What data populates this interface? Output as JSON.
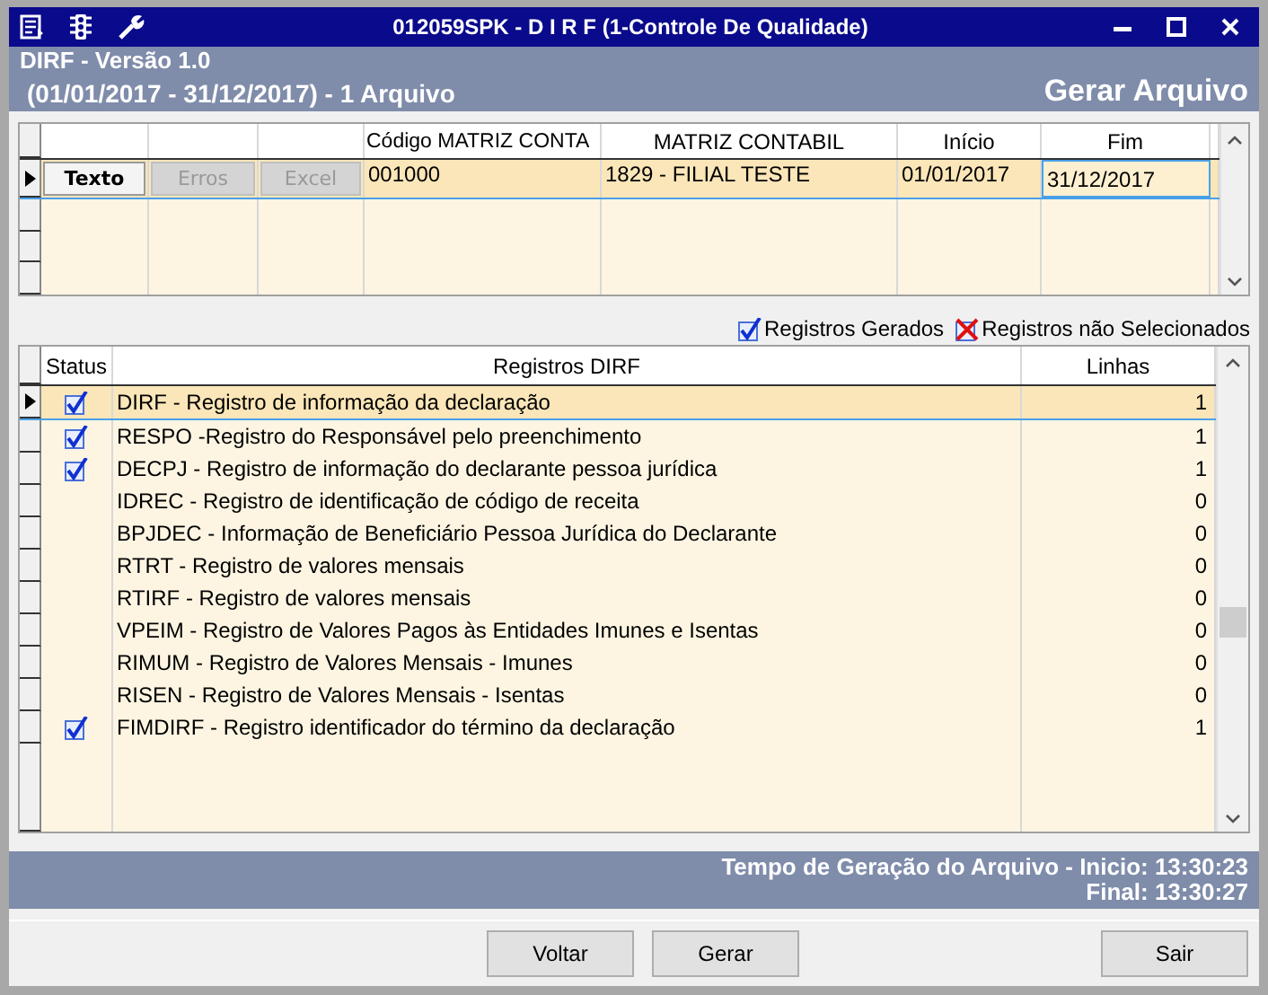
{
  "window": {
    "title": "012059SPK - D I R F (1-Controle De Qualidade)"
  },
  "header": {
    "version": "DIRF - Versão 1.0",
    "period": "(01/01/2017 - 31/12/2017) - 1 Arquivo",
    "action": "Gerar Arquivo"
  },
  "files_table": {
    "columns": [
      "Código MATRIZ CONTA",
      "MATRIZ CONTABIL",
      "Início",
      "Fim"
    ],
    "rows": [
      {
        "selected": true,
        "buttons": [
          {
            "label": "Texto",
            "disabled": false
          },
          {
            "label": "Erros",
            "disabled": true
          },
          {
            "label": "Excel",
            "disabled": true
          }
        ],
        "cells": [
          "001000",
          "1829 - FILIAL TESTE",
          "01/01/2017",
          "31/12/2017"
        ]
      }
    ]
  },
  "legend": [
    {
      "kind": "generated",
      "label": "Registros Gerados"
    },
    {
      "kind": "not_selected",
      "label": "Registros não Selecionados"
    }
  ],
  "records_table": {
    "columns": [
      "Status",
      "Registros DIRF",
      "Linhas"
    ],
    "rows": [
      {
        "selected": true,
        "checked": true,
        "text": "DIRF - Registro de informação da declaração",
        "lines": "1"
      },
      {
        "selected": false,
        "checked": true,
        "text": "RESPO -Registro do Responsável pelo preenchimento",
        "lines": "1"
      },
      {
        "selected": false,
        "checked": true,
        "text": "DECPJ - Registro de informação do declarante pessoa jurídica",
        "lines": "1"
      },
      {
        "selected": false,
        "checked": false,
        "text": "IDREC - Registro de identificação de código de receita",
        "lines": "0"
      },
      {
        "selected": false,
        "checked": false,
        "text": "BPJDEC - Informação de Beneficiário Pessoa Jurídica do Declarante",
        "lines": "0"
      },
      {
        "selected": false,
        "checked": false,
        "text": "RTRT - Registro de valores mensais",
        "lines": "0"
      },
      {
        "selected": false,
        "checked": false,
        "text": "RTIRF - Registro de valores mensais",
        "lines": "0"
      },
      {
        "selected": false,
        "checked": false,
        "text": "VPEIM - Registro de Valores Pagos às Entidades Imunes e Isentas",
        "lines": "0"
      },
      {
        "selected": false,
        "checked": false,
        "text": "RIMUM - Registro de Valores Mensais - Imunes",
        "lines": "0"
      },
      {
        "selected": false,
        "checked": false,
        "text": "RISEN - Registro de Valores Mensais - Isentas",
        "lines": "0"
      },
      {
        "selected": false,
        "checked": true,
        "text": "FIMDIRF - Registro identificador do término da declaração",
        "lines": "1"
      }
    ]
  },
  "status": {
    "start": "Tempo de Geração do Arquivo - Inicio: 13:30:23",
    "end": "Final: 13:30:27"
  },
  "buttons": [
    {
      "label": "Voltar"
    },
    {
      "label": "Gerar"
    },
    {
      "label": "Sair"
    }
  ]
}
